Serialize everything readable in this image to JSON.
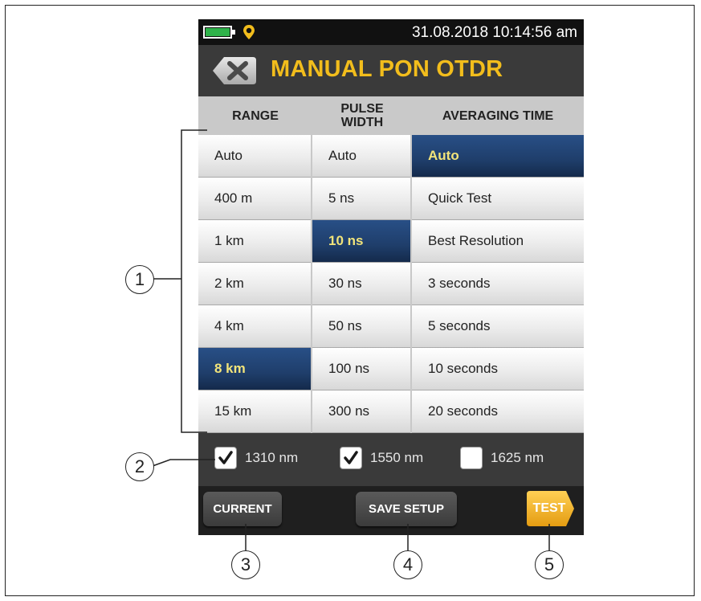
{
  "status": {
    "datetime": "31.08.2018 10:14:56 am",
    "battery_color": "#2fb34a"
  },
  "header": {
    "title": "MANUAL PON OTDR",
    "back_icon": "close-x-icon",
    "title_color": "#f2bd1c"
  },
  "columns": {
    "range": "RANGE",
    "pulse_width_line1": "PULSE",
    "pulse_width_line2": "WIDTH",
    "averaging_time": "AVERAGING TIME"
  },
  "range": [
    "Auto",
    "400 m",
    "1 km",
    "2 km",
    "4 km",
    "8 km",
    "15 km"
  ],
  "range_selected": "8 km",
  "pulse_width": [
    "Auto",
    "5 ns",
    "10 ns",
    "30 ns",
    "50 ns",
    "100 ns",
    "300 ns"
  ],
  "pulse_width_selected": "10 ns",
  "averaging_time": [
    "Auto",
    "Quick Test",
    "Best Resolution",
    "3 seconds",
    "5 seconds",
    "10 seconds",
    "20 seconds"
  ],
  "averaging_time_selected": "Auto",
  "wavelengths": [
    {
      "label": "1310 nm",
      "checked": true
    },
    {
      "label": "1550 nm",
      "checked": true
    },
    {
      "label": "1625 nm",
      "checked": false
    }
  ],
  "buttons": {
    "current": "CURRENT",
    "save_setup": "SAVE SETUP",
    "test": "TEST"
  },
  "callouts": [
    "1",
    "2",
    "3",
    "4",
    "5"
  ],
  "colors": {
    "selected_bg": "#1f3e6b",
    "selected_text": "#f2e47a",
    "test_button": "#f0b323"
  }
}
